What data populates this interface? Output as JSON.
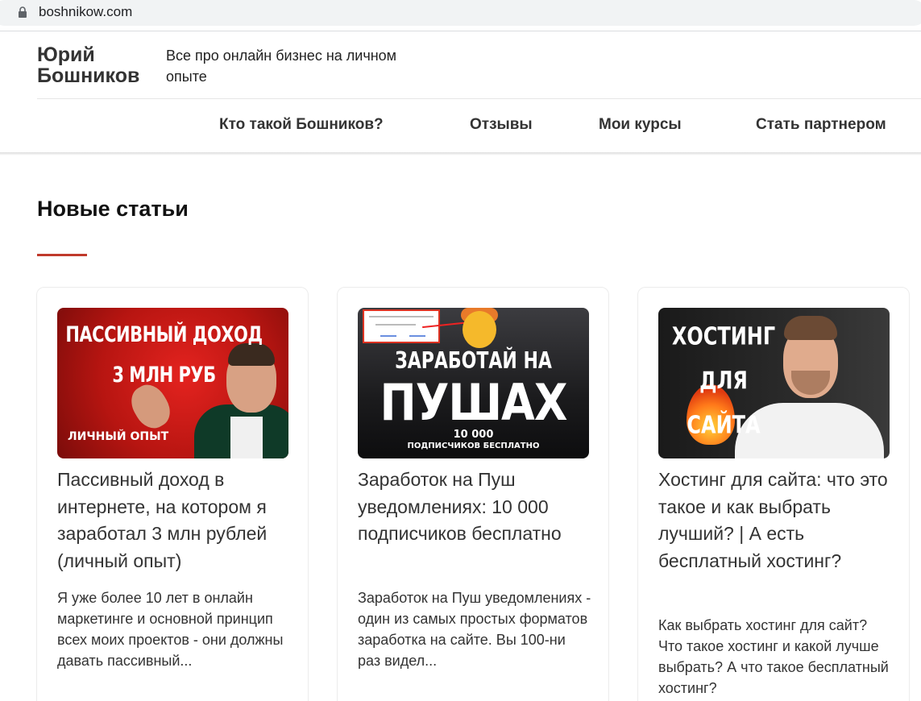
{
  "browser": {
    "url": "boshnikow.com",
    "lock_icon": "lock-icon"
  },
  "header": {
    "logo_line1": "Юрий",
    "logo_line2": "Бошников",
    "tagline": "Все про онлайн бизнес на личном опыте"
  },
  "nav": {
    "items": [
      {
        "label": "Кто такой Бошников?"
      },
      {
        "label": "Отзывы"
      },
      {
        "label": "Мои курсы"
      },
      {
        "label": "Стать партнером"
      }
    ]
  },
  "section": {
    "title": "Новые статьи",
    "accent_color": "#c0392b"
  },
  "articles": [
    {
      "thumb": {
        "headline_line1": "ПАССИВНЫЙ ДОХОД",
        "headline_line2": "3 МЛН РУБ",
        "subtitle": "ЛИЧНЫЙ ОПЫТ"
      },
      "title": "Пассивный доход в интернете, на котором я заработал 3 млн рублей (личный опыт)",
      "excerpt": "Я уже более 10 лет в онлайн маркетинге и основной принцип всех моих проектов - они должны давать пассивный..."
    },
    {
      "thumb": {
        "headline_line1": "ЗАРАБОТАЙ НА",
        "headline_line2": "ПУШАХ",
        "sub_line1": "10 000",
        "sub_line2": "ПОДПИСЧИКОВ БЕСПЛАТНО"
      },
      "title": "Заработок на Пуш уведомлениях: 10 000 подписчиков бесплатно",
      "excerpt": "Заработок на Пуш уведомлениях - один из самых простых форматов заработка на сайте. Вы 100-ни раз видел..."
    },
    {
      "thumb": {
        "headline_line1": "ХОСТИНГ",
        "headline_line2": "ДЛЯ САЙТА"
      },
      "title": "Хостинг для сайта: что это такое и как выбрать лучший? | А есть бесплатный хостинг?",
      "excerpt": "Как выбрать хостинг для сайт? Что такое хостинг и какой лучше выбрать? А что такое бесплатный хостинг?"
    }
  ]
}
